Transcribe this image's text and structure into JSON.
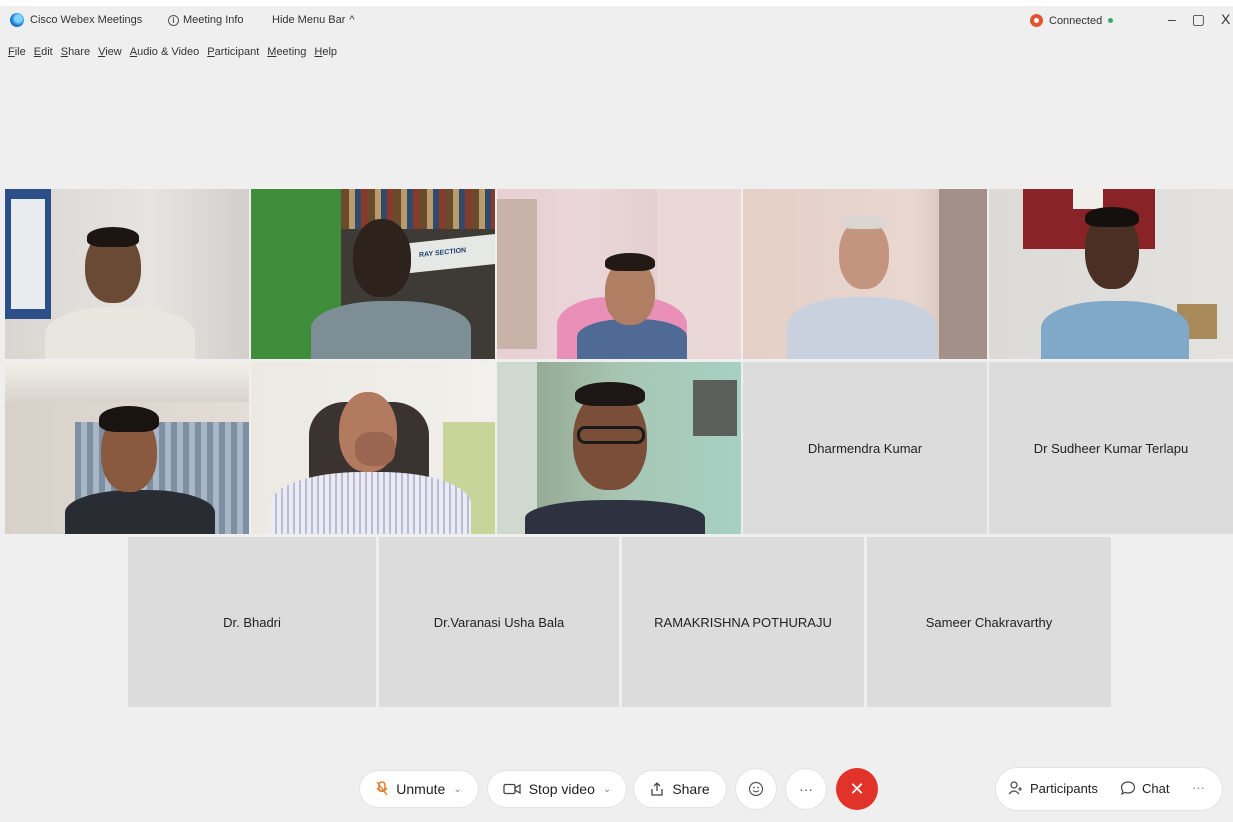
{
  "titlebar": {
    "app_title": "Cisco Webex Meetings",
    "meeting_info": "Meeting Info",
    "hide_menu": "Hide Menu Bar",
    "hide_menu_chevron": "^",
    "connection_status": "Connected",
    "minimize": "–",
    "restore": "▢",
    "close": "X"
  },
  "menu": [
    "File",
    "Edit",
    "Share",
    "View",
    "Audio & Video",
    "Participant",
    "Meeting",
    "Help"
  ],
  "name_tiles": [
    "Dharmendra Kumar",
    "Dr Sudheer Kumar Terlapu",
    "Dr. Bhadri",
    "Dr.Varanasi Usha Bala",
    "RAMAKRISHNA POTHURAJU",
    "Sameer Chakravarthy"
  ],
  "video_overlay_text": "RAY SECTION",
  "toolbar": {
    "unmute": "Unmute",
    "stop_video": "Stop video",
    "share": "Share",
    "more": "···",
    "end": "✕",
    "participants": "Participants",
    "chat": "Chat",
    "panel_more": "···"
  },
  "colors": {
    "end_call": "#e2332a",
    "recording": "#e4532f",
    "connected": "#3aa66a",
    "mic_muted": "#e07b2e"
  }
}
